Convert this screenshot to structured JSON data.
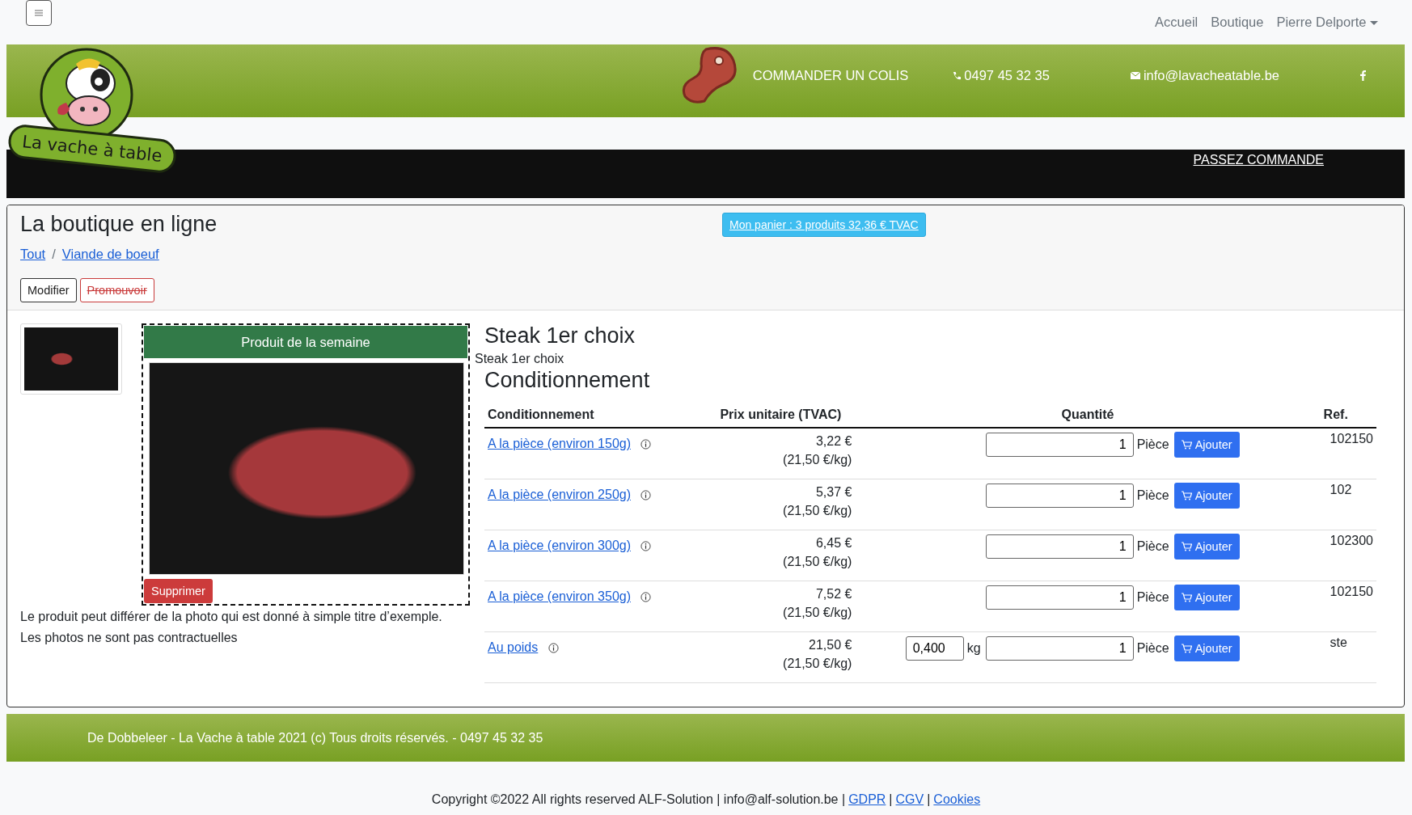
{
  "topnav": {
    "links": [
      "Accueil",
      "Boutique"
    ],
    "user": "Pierre Delporte"
  },
  "header": {
    "logo_text": "La vache à table",
    "order_link": "COMMANDER UN COLIS",
    "phone": "0497 45 32 35",
    "email": "info@lavacheatable.be"
  },
  "black_bar": {
    "link": "PASSEZ COMMANDE"
  },
  "shop": {
    "title": "La boutique en ligne",
    "breadcrumb": [
      "Tout",
      "Viande de boeuf"
    ],
    "breadcrumb_separator": "/",
    "cart_button": "Mon panier : 3 produits 32,36 € TVAC",
    "actions": [
      {
        "label": "Modifier",
        "kind": "edit"
      },
      {
        "label": "Promouvoir",
        "kind": "promote"
      }
    ]
  },
  "product": {
    "featured_label": "Produit de la semaine",
    "delete_button": "Supprimer",
    "disclaimer": [
      "Le produit peut différer de la photo qui est donné à simple titre d’exemple.",
      "Les photos ne sont pas contractuelles"
    ],
    "title": "Steak 1er choix",
    "subtitle": "Steak 1er choix",
    "section_title": "Conditionnement",
    "table": {
      "columns": [
        "Conditionnement",
        "Prix unitaire (TVAC)",
        "Quantité",
        "Ref."
      ],
      "rows": [
        {
          "kind": "piece",
          "name": "A la pièce (environ 150g)",
          "price": "3,22 €",
          "per_kg": "(21,50 €/kg)",
          "quantity": "1",
          "unit": "Pièce",
          "button": "Ajouter",
          "ref": "102150"
        },
        {
          "kind": "piece",
          "name": "A la pièce (environ 250g)",
          "price": "5,37 €",
          "per_kg": "(21,50 €/kg)",
          "quantity": "1",
          "unit": "Pièce",
          "button": "Ajouter",
          "ref": "102"
        },
        {
          "kind": "piece",
          "name": "A la pièce (environ 300g)",
          "price": "6,45 €",
          "per_kg": "(21,50 €/kg)",
          "quantity": "1",
          "unit": "Pièce",
          "button": "Ajouter",
          "ref": "102300"
        },
        {
          "kind": "piece",
          "name": "A la pièce (environ 350g)",
          "price": "7,52 €",
          "per_kg": "(21,50 €/kg)",
          "quantity": "1",
          "unit": "Pièce",
          "button": "Ajouter",
          "ref": "102150"
        },
        {
          "kind": "weight",
          "name": "Au poids",
          "price": "21,50 €",
          "per_kg": "(21,50 €/kg)",
          "weight": "0,400",
          "weight_unit": "kg",
          "quantity": "1",
          "unit": "Pièce",
          "button": "Ajouter",
          "ref": "ste"
        }
      ]
    }
  },
  "footer": {
    "text": "De Dobbeleer - La Vache à table 2021 (c) Tous droits réservés. - 0497 45 32 35"
  },
  "copyright": {
    "text": "Copyright ©2022 All rights reserved ALF-Solution | info@alf-solution.be |",
    "links": [
      "GDPR",
      "CGV",
      "Cookies"
    ],
    "separator": "|"
  }
}
